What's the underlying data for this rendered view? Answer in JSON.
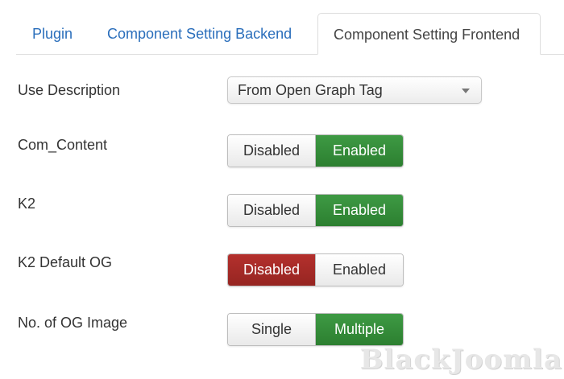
{
  "tabs": [
    {
      "label": "Plugin",
      "active": false
    },
    {
      "label": "Component Setting Backend",
      "active": false
    },
    {
      "label": "Component Setting Frontend",
      "active": true
    }
  ],
  "settings": {
    "use_description": {
      "label": "Use Description",
      "value": "From Open Graph Tag"
    },
    "com_content": {
      "label": "Com_Content",
      "options": [
        "Disabled",
        "Enabled"
      ],
      "selected": "Enabled"
    },
    "k2": {
      "label": "K2",
      "options": [
        "Disabled",
        "Enabled"
      ],
      "selected": "Enabled"
    },
    "k2_default_og": {
      "label": "K2 Default OG",
      "options": [
        "Disabled",
        "Enabled"
      ],
      "selected": "Disabled"
    },
    "og_image": {
      "label": "No. of OG Image",
      "options": [
        "Single",
        "Multiple"
      ],
      "selected": "Multiple"
    }
  },
  "colors": {
    "enabled": "#2e8534",
    "disabled": "#a22a27",
    "link": "#2a6ebb"
  },
  "watermark": "BlackJoomla"
}
